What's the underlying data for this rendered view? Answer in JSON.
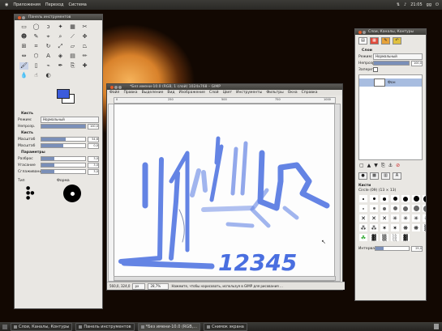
{
  "topbar": {
    "menu_apps": "Приложения",
    "menu_places": "Переход",
    "menu_system": "Система",
    "clock": "21:05",
    "user": "gg"
  },
  "toolbox": {
    "title": "Панель инструментов",
    "fg_color": "#3b5bdb",
    "bg_color": "#ffffff",
    "options_title": "Кисть",
    "mode_label": "Режим:",
    "mode_value": "Нормальный",
    "opacity_label": "Непрозр.",
    "opacity_value": "100,0",
    "brush_label": "Кисть",
    "scale_label": "Масштаб",
    "scale_value": "1,00",
    "dynamics_label": "Параметры",
    "size_value": "54,6",
    "aspect_value": "0,0",
    "jitter_label": "Разброс",
    "fade_label": "Угасание",
    "smooth_label": "Сглаживание",
    "smooth_value1": "3,0",
    "smooth_value2": "3,0",
    "smooth_value3": "3,0",
    "brush_preview_label": "Форма",
    "type_label": "Тип"
  },
  "image_window": {
    "title": "*Без имени-10.0 (RGB, 1 слой) 1024x768 – GIMP",
    "menu": [
      "Файл",
      "Правка",
      "Выделение",
      "Вид",
      "Изображение",
      "Слой",
      "Цвет",
      "Инструменты",
      "Фильтры",
      "Окна",
      "Справка"
    ],
    "ruler_marks": [
      "0",
      "250",
      "500",
      "750",
      "1000"
    ],
    "drawn_text": "12345",
    "coords": "560,0, 324,0",
    "unit": "px",
    "zoom": "28,7%",
    "status_message": "Нажмите, чтобы нарисовать, используя в GIMP для рисования …"
  },
  "right_dock": {
    "title": "Слои, Каналы, Контуры",
    "layers_label": "Слои",
    "mode_label": "Режим:",
    "mode_value": "Нормальный",
    "opacity_label": "Непрозр.:",
    "opacity_value": "100,0",
    "lock_label": "Запереть:",
    "layer_name": "Фон",
    "brushes_label": "Кисти",
    "brush_name": "Circle (09) (13 × 13)",
    "spacing_label": "Интервал:",
    "spacing_value": "25,0"
  },
  "taskbar": {
    "items": [
      "Слои, Каналы, Контуры",
      "Панель инструментов",
      "*Без имени-10.0 (RGB,...",
      "Снимок экрана"
    ]
  }
}
